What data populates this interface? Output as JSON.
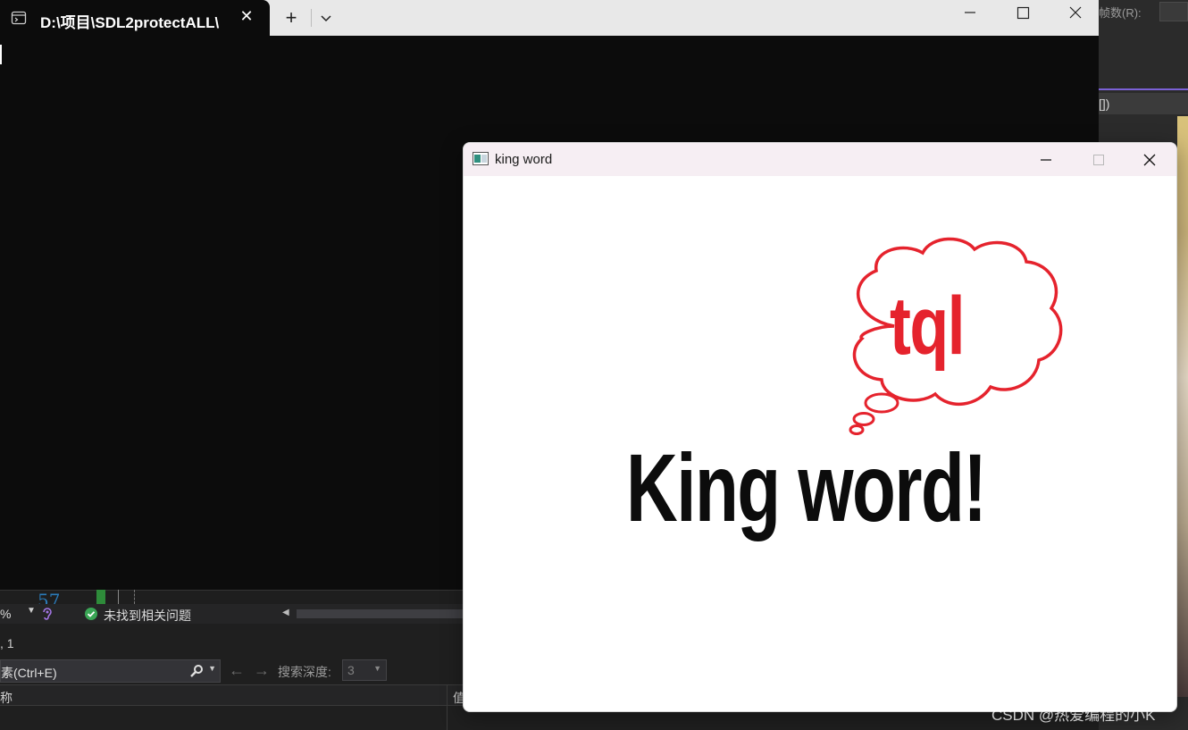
{
  "terminal": {
    "tab_title": "D:\\项目\\SDL2protectALL\\",
    "tab_close_glyph": "✕",
    "new_tab_glyph": "+",
    "dropdown_icon": "chevron-down-icon"
  },
  "sdl_window": {
    "title": "king word",
    "bubble_text": "tql",
    "headline": "King word!",
    "bubble_color": "#e5232d",
    "headline_color": "#0c0c0c"
  },
  "ide": {
    "frames_label": "帧数(R):",
    "bracket_text": "[])",
    "line_number": "57",
    "zoom_text": "%",
    "status_text": "未找到相关问题",
    "row_text": ", 1",
    "search_placeholder": "素(Ctrl+E)",
    "search_depth_label": "搜索深度:",
    "search_depth_value": "3",
    "col_name": "称",
    "col_value": "值",
    "status_ok_color": "#3aa655"
  },
  "watermark": "CSDN @热爱编程的小K"
}
